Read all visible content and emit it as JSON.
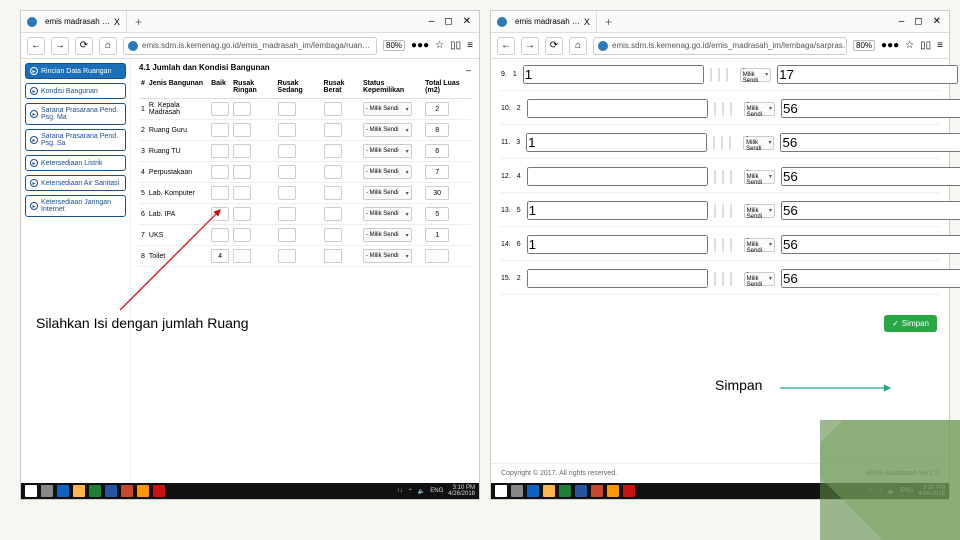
{
  "tab_title": "emis madrasah …",
  "url_left": "emis.sdm.is.kemenag.go.id/emis_madrasah_im/lembaga/ruan…",
  "url_right": "emis.sdm.is.kemenag.go.id/emis_madrasah_im/lembaga/sarpras…",
  "zoom": "80%",
  "close_x": "X",
  "plus": "+",
  "win_min": "–",
  "win_max": "◻",
  "win_close": "✕",
  "nav_back": "←",
  "nav_fwd": "→",
  "nav_reload": "⟳",
  "nav_home": "⌂",
  "nav_shield": "●●●",
  "nav_star": "☆",
  "nav_book": "▯▯",
  "nav_menu": "≡",
  "sidebar": {
    "items": [
      {
        "label": "Rincian Data Ruangan"
      },
      {
        "label": "Kondisi Bangunan"
      },
      {
        "label": "Sarana Prasarana Pend. Psg. Ma"
      },
      {
        "label": "Sarana Prasarana Pend. Psg. Sa"
      },
      {
        "label": "Ketersediaan Listrik"
      },
      {
        "label": "Ketersediaan Air Sanitasi"
      },
      {
        "label": "Ketersediaan Jaringan Internet"
      }
    ]
  },
  "section": "4.1 Jumlah dan Kondisi Bangunan",
  "toggle": "–",
  "headers": {
    "no": "#",
    "jenis": "Jenis Bangunan",
    "baik": "Baik",
    "rr": "Rusak Ringan",
    "rs": "Rusak Sedang",
    "rb": "Rusak Berat",
    "status": "Status Kepemilikan",
    "luas": "Total Luas (m2)"
  },
  "rows_left": [
    {
      "n": "1",
      "name": "R. Kepala Madrasah",
      "baik": "",
      "status": "- Milik Sendi",
      "luas": "2"
    },
    {
      "n": "2",
      "name": "Ruang Guru",
      "baik": "",
      "status": "- Milik Sendi",
      "luas": "8"
    },
    {
      "n": "3",
      "name": "Ruang TU",
      "baik": "",
      "status": "- Milik Sendi",
      "luas": "6"
    },
    {
      "n": "4",
      "name": "Perpustakaan",
      "baik": "",
      "status": "- Milik Sendi",
      "luas": "7"
    },
    {
      "n": "5",
      "name": "Lab. Komputer",
      "baik": "",
      "status": "- Milik Sendi",
      "luas": "30"
    },
    {
      "n": "6",
      "name": "Lab. IPA",
      "baik": "",
      "status": "- Milik Sendi",
      "luas": "5"
    },
    {
      "n": "7",
      "name": "UKS",
      "baik": "",
      "status": "- Milik Sendi",
      "luas": "1"
    },
    {
      "n": "8",
      "name": "Toilet",
      "baik": "4",
      "status": "- Milik Sendi",
      "luas": ""
    }
  ],
  "rows_right": [
    {
      "n": "9",
      "k": "1",
      "baik": "1",
      "status": "- Milik Sendi",
      "luas": "17"
    },
    {
      "n": "10",
      "k": "2",
      "baik": "",
      "status": "- Milik Sendi",
      "luas": "56"
    },
    {
      "n": "11",
      "k": "3",
      "baik": "1",
      "status": "- Milik Sendi",
      "luas": "56"
    },
    {
      "n": "12",
      "k": "4",
      "baik": "",
      "status": "- Milik Sendi",
      "luas": "56"
    },
    {
      "n": "13",
      "k": "5",
      "baik": "1",
      "status": "- Milik Sendi",
      "luas": "56"
    },
    {
      "n": "14",
      "k": "6",
      "baik": "1",
      "status": "- Milik Sendi",
      "luas": "56"
    },
    {
      "n": "15",
      "k": "2",
      "baik": "",
      "status": "- Milik Sendi",
      "luas": "56"
    }
  ],
  "save_label": "Simpan",
  "save_icon": "✓",
  "copyright": "Copyright © 2017. All rights reserved.",
  "version": "EMIS-Madrasah Ver1.0",
  "annot_fill": "Silahkan Isi dengan jumlah Ruang",
  "annot_save": "Simpan",
  "tray": {
    "net": "↑↓",
    "wifi": "⌃",
    "snd": "🔈",
    "lang": "ENG"
  },
  "time_left": {
    "t": "3:10 PM",
    "d": "4/26/2018"
  },
  "time_right": {
    "t": "3:20 PM",
    "d": "4/26/2018"
  }
}
